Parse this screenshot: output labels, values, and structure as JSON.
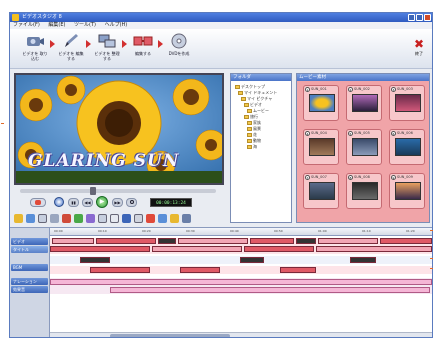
{
  "window": {
    "title": "ビデオスタジオ 8"
  },
  "menu": {
    "items": [
      "ファイル(F)",
      "編集(E)",
      "ツール(T)",
      "ヘルプ(H)"
    ]
  },
  "toolbar": {
    "steps": [
      {
        "label": "ビデオを\n取り込む",
        "icon": "camera-icon"
      },
      {
        "label": "ビデオを\n編集する",
        "icon": "pen-icon"
      },
      {
        "label": "ビデオを\n整理する",
        "icon": "monitor-icon"
      },
      {
        "label": "編集する",
        "icon": "film-icon"
      },
      {
        "label": "DVDを作成",
        "icon": "disc-icon"
      }
    ],
    "exit_label": "終了"
  },
  "preview": {
    "title_text": "GLARING SUN"
  },
  "transport": {
    "timecode": "00:00:13:24",
    "buttons": [
      "▮▮",
      "◀◀",
      "▶",
      "▶▶"
    ]
  },
  "folder_panel": {
    "title": "フォルダ",
    "tree": [
      "デスクトップ",
      "マイ ドキュメント",
      "マイ ピクチャ",
      "ビデオ",
      "ムービー",
      "旅行",
      "家族",
      "風景",
      "花",
      "動物",
      "海"
    ]
  },
  "media_panel": {
    "title": "ムービー素材",
    "items": [
      {
        "num": "1",
        "name": "SUN_001"
      },
      {
        "num": "2",
        "name": "SUN_002"
      },
      {
        "num": "3",
        "name": "SUN_003"
      },
      {
        "num": "4",
        "name": "SUN_004"
      },
      {
        "num": "5",
        "name": "SUN_005"
      },
      {
        "num": "6",
        "name": "SUN_006"
      },
      {
        "num": "7",
        "name": "SUN_007"
      },
      {
        "num": "8",
        "name": "SUN_008"
      },
      {
        "num": "9",
        "name": "SUN_009"
      }
    ]
  },
  "timeline": {
    "ruler": [
      "00:00",
      "00:10",
      "00:20",
      "00:30",
      "00:40",
      "00:50",
      "01:00",
      "01:10",
      "01:20"
    ],
    "tracks": [
      "ビデオ",
      "タイトル",
      "BGM",
      "ナレーション",
      "効果音"
    ]
  },
  "colors": {
    "accent": "#3d66b8",
    "media_bg": "#f0a4a8",
    "clip_pink": "#f2a6b4"
  }
}
